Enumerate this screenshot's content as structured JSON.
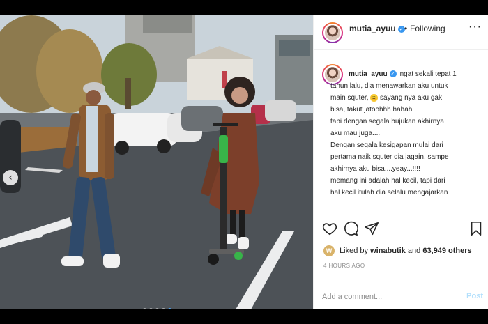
{
  "post": {
    "username": "mutia_ayuu",
    "verified_mark": "✓",
    "separator": "•",
    "follow_state": "Following",
    "more_glyph": "···",
    "caption_lines": [
      "ingat sekali tepat 1",
      "tahun lalu, dia menawarkan aku untuk",
      "main squter,",
      "sayang nya aku gak",
      "bisa, takut jatoohhh hahah",
      "tapi dengan segala bujukan akhirnya",
      "aku mau juga....",
      "Dengan segala kesigapan mulai dari",
      "pertama naik squter dia jagain, sampe",
      "akhirnya aku bisa....yeay...!!!!",
      "memang ini adalah hal kecil, tapi dari",
      "hal kecil itulah dia selalu mengajarkan"
    ],
    "emoji": "😄",
    "liked_prefix": "Liked by",
    "liked_user": "winabutik",
    "liked_and": "and",
    "likes_count": "63,949 others",
    "liked_avatar_letter": "W",
    "time_ago": "4 HOURS AGO",
    "comment_placeholder": "Add a comment...",
    "post_label": "Post",
    "prev_glyph": "‹"
  },
  "carousel": {
    "slides": 5,
    "active_index": 4
  },
  "icons": [
    "heart-icon",
    "comment-icon",
    "share-icon",
    "bookmark-icon",
    "more-icon",
    "chevron-left-icon",
    "verified-icon"
  ],
  "colors": {
    "accent": "#3897f0",
    "active_dot": "#4aa3f5",
    "post_disabled": "#b2dffc",
    "muted": "#8e8e8e"
  }
}
